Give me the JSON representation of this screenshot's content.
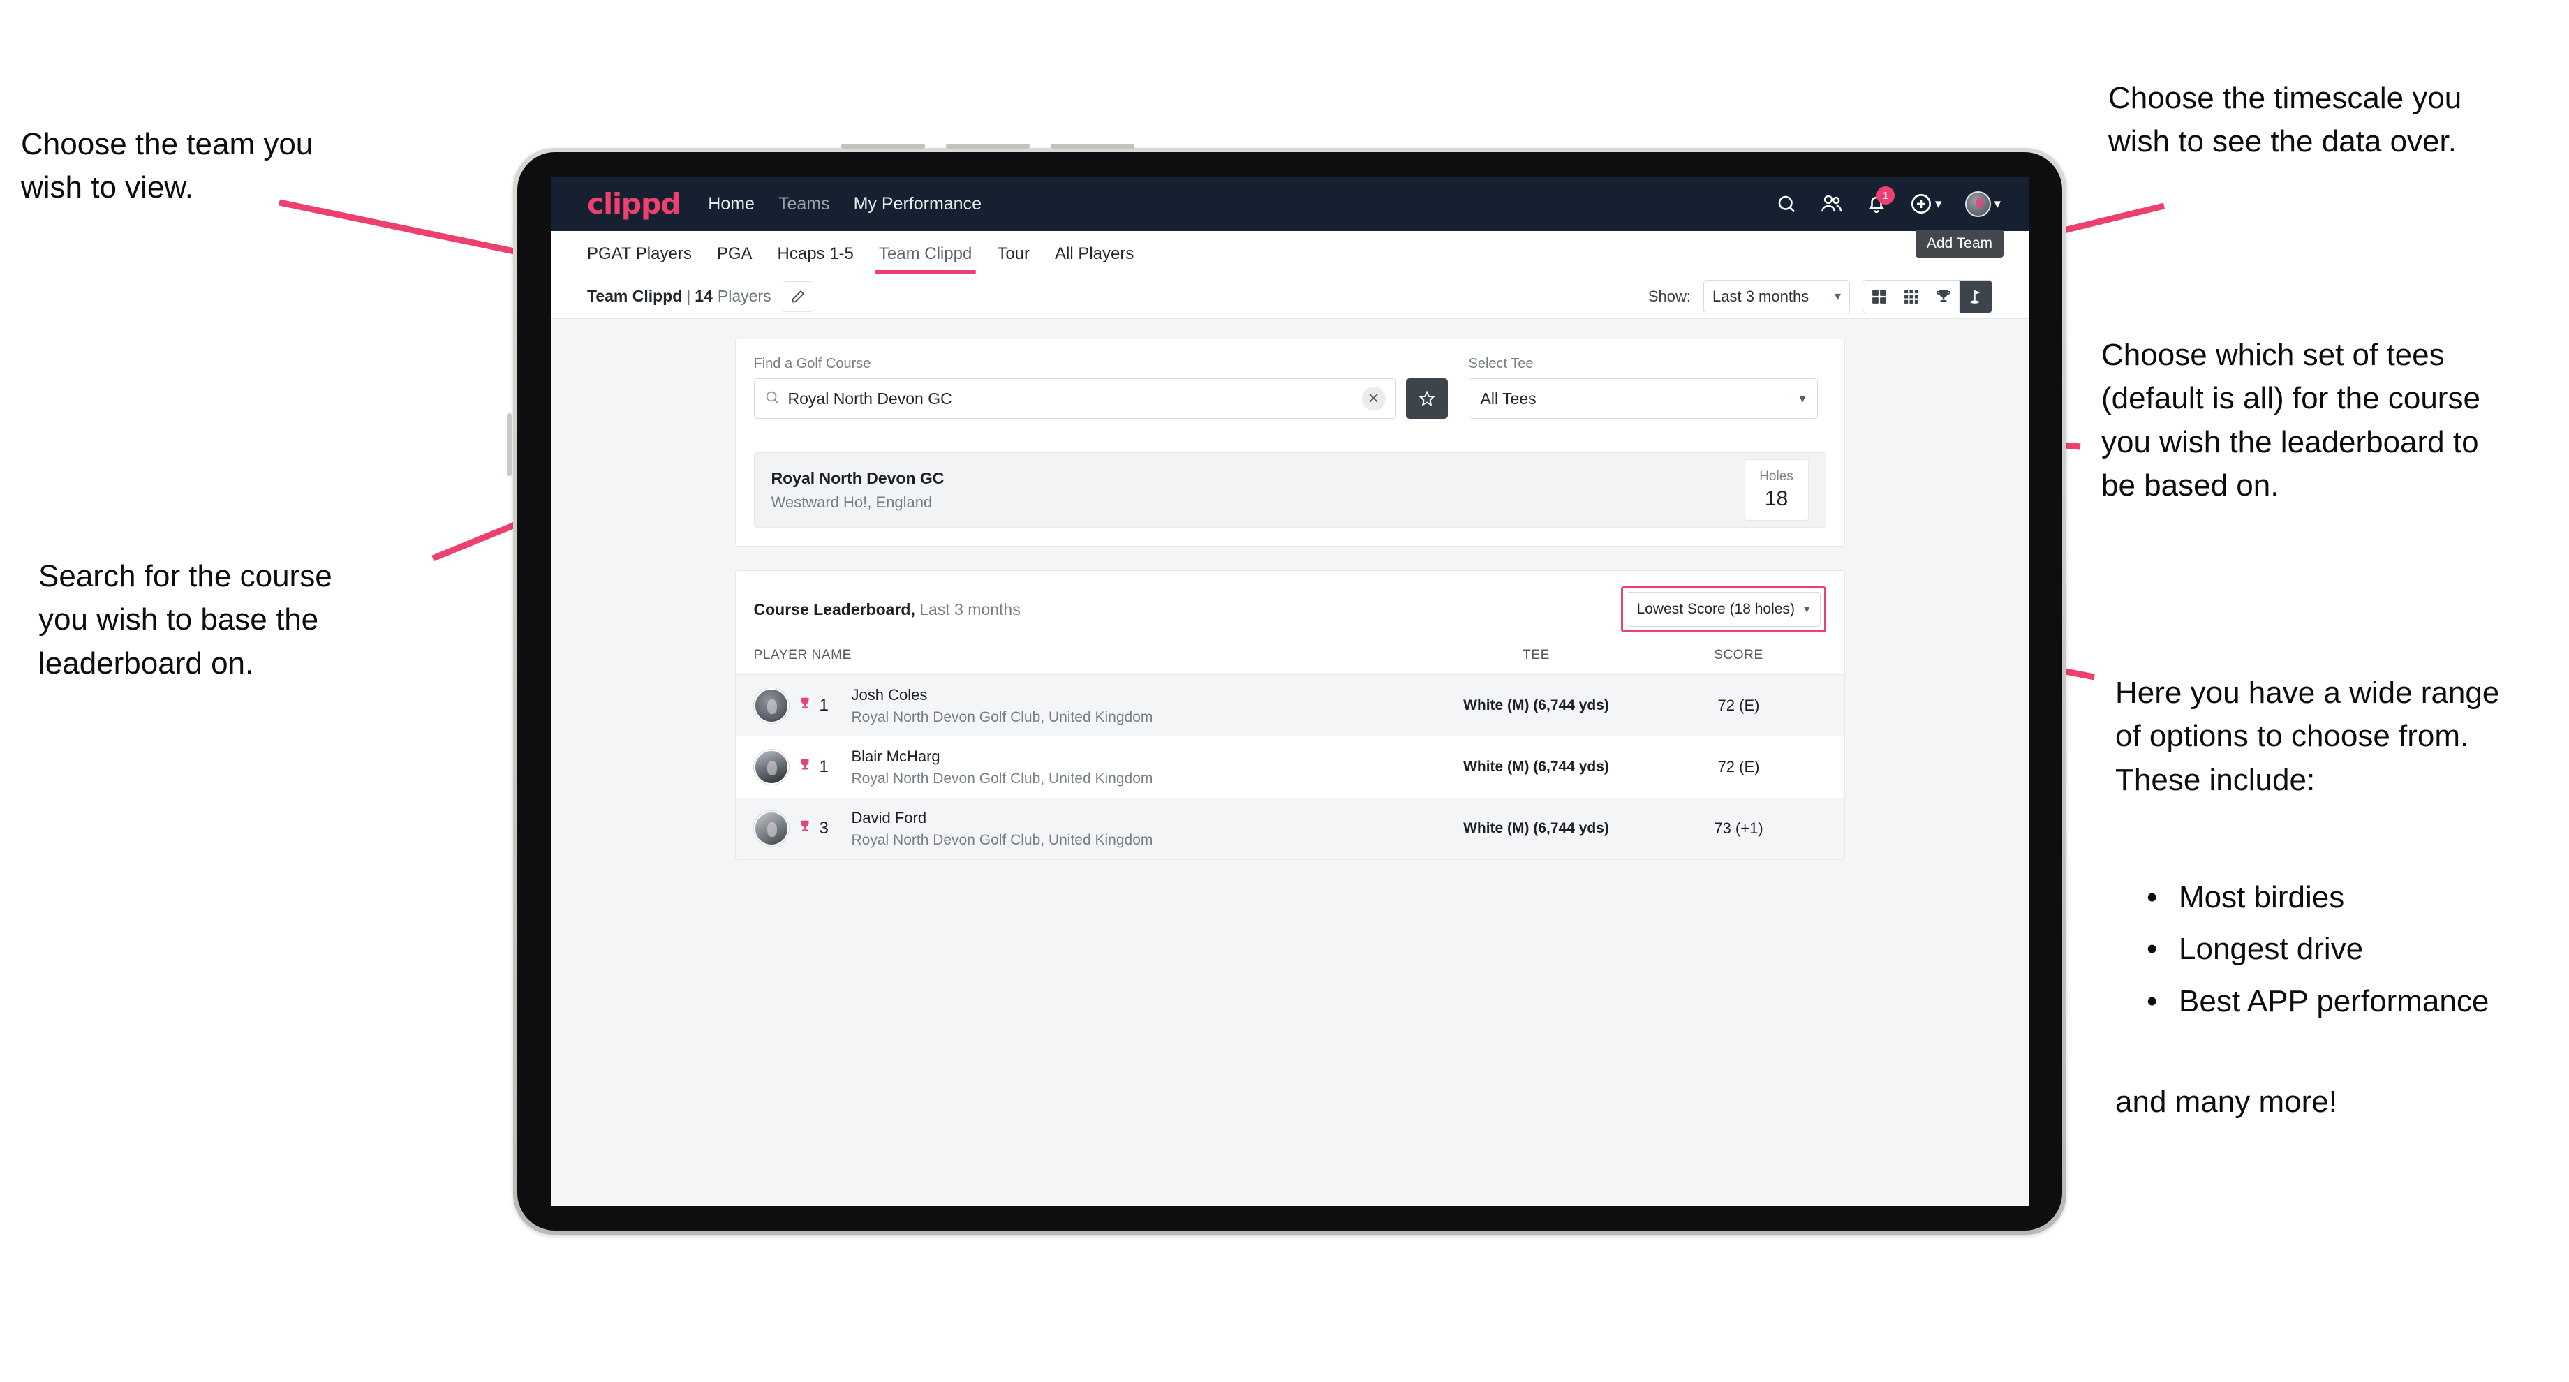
{
  "annotations": {
    "team": "Choose the team you\nwish to view.",
    "timescale": "Choose the timescale you\nwish to see the data over.",
    "tees": "Choose which set of tees\n(default is all) for the course\nyou wish the leaderboard to\nbe based on.",
    "search": "Search for the course\nyou wish to base the\nleaderboard on.",
    "options_intro": "Here you have a wide range\nof options to choose from.\nThese include:",
    "options_list": [
      "Most birdies",
      "Longest drive",
      "Best APP performance"
    ],
    "options_outro": "and many more!"
  },
  "app": {
    "brand": "clippd",
    "nav": [
      {
        "label": "Home",
        "dim": false
      },
      {
        "label": "Teams",
        "dim": true
      },
      {
        "label": "My Performance",
        "dim": false
      }
    ],
    "icons": {
      "search": "search-icon",
      "people": "people-icon",
      "bell": "bell-icon",
      "plus": "plus-circle-icon",
      "avatar": "avatar-icon"
    },
    "notification_count": "1",
    "tooltip": "Add Team",
    "tabs": [
      {
        "label": "PGAT Players",
        "state": "normal"
      },
      {
        "label": "PGA",
        "state": "normal"
      },
      {
        "label": "Hcaps 1-5",
        "state": "normal"
      },
      {
        "label": "Team Clippd",
        "state": "active"
      },
      {
        "label": "Tour",
        "state": "normal"
      },
      {
        "label": "All Players",
        "state": "normal"
      }
    ],
    "toolbar": {
      "team_name": "Team Clippd",
      "team_sep": "|",
      "player_count": "14",
      "players_word": "Players",
      "edit_icon": "pencil-icon",
      "show_label": "Show:",
      "timescale_value": "Last 3 months",
      "views": [
        {
          "name": "grid-2x2-view",
          "active": false
        },
        {
          "name": "grid-3x3-view",
          "active": false
        },
        {
          "name": "trophy-view",
          "active": false
        },
        {
          "name": "flag-view",
          "active": true
        }
      ]
    },
    "search_panel": {
      "course_label": "Find a Golf Course",
      "course_value": "Royal North Devon GC",
      "course_placeholder": "Find a Golf Course",
      "clear_icon": "close-icon",
      "star_icon": "star-icon",
      "tee_label": "Select Tee",
      "tee_value": "All Tees"
    },
    "course_result": {
      "name": "Royal North Devon GC",
      "location": "Westward Ho!, England",
      "holes_label": "Holes",
      "holes_value": "18"
    },
    "leaderboard": {
      "title": "Course Leaderboard,",
      "subtitle": " Last 3 months",
      "metric_value": "Lowest Score (18 holes)",
      "columns": [
        "PLAYER NAME",
        "TEE",
        "SCORE"
      ],
      "rows": [
        {
          "rank": "1",
          "name": "Josh Coles",
          "club": "Royal North Devon Golf Club, United Kingdom",
          "tee": "White (M) (6,744 yds)",
          "score": "72 (E)"
        },
        {
          "rank": "1",
          "name": "Blair McHarg",
          "club": "Royal North Devon Golf Club, United Kingdom",
          "tee": "White (M) (6,744 yds)",
          "score": "72 (E)"
        },
        {
          "rank": "3",
          "name": "David Ford",
          "club": "Royal North Devon Golf Club, United Kingdom",
          "tee": "White (M) (6,744 yds)",
          "score": "73 (+1)"
        }
      ]
    }
  },
  "colors": {
    "accent": "#ee3f71",
    "appbar": "#152030",
    "dark_btn": "#3d444b",
    "page_bg": "#f4f5f7"
  }
}
